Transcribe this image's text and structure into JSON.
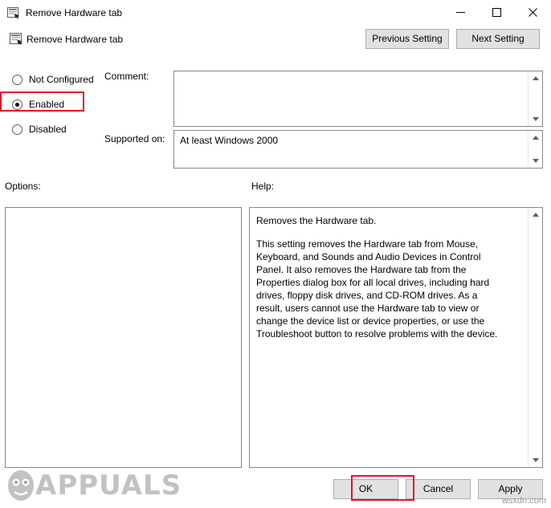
{
  "window": {
    "title": "Remove Hardware tab",
    "icon": "policy-setting-icon",
    "minimize_label": "─",
    "maximize_label": "☐",
    "close_label": "✕"
  },
  "header": {
    "icon": "policy-setting-icon",
    "title": "Remove Hardware tab",
    "previous_setting_label": "Previous Setting",
    "next_setting_label": "Next Setting"
  },
  "state_options": [
    {
      "label": "Not Configured",
      "selected": false
    },
    {
      "label": "Enabled",
      "selected": true
    },
    {
      "label": "Disabled",
      "selected": false
    }
  ],
  "comment": {
    "label": "Comment:",
    "value": "",
    "placeholder": ""
  },
  "supported_on": {
    "label": "Supported on:",
    "value": "At least Windows 2000"
  },
  "options": {
    "label": "Options:",
    "value": ""
  },
  "help": {
    "label": "Help:",
    "paragraphs": [
      "Removes the Hardware tab.",
      "This setting removes the Hardware tab from Mouse, Keyboard, and Sounds and Audio Devices in Control Panel. It also removes the Hardware tab from the Properties dialog box for all local drives, including hard drives, floppy disk drives, and CD-ROM drives. As a result, users cannot use the Hardware tab to view or change the device list or device properties, or use the Troubleshoot button to resolve problems with the device."
    ]
  },
  "footer": {
    "ok_label": "OK",
    "cancel_label": "Cancel",
    "apply_label": "Apply"
  },
  "watermark": {
    "text": "APPUALS",
    "corner": "wsxdn.com"
  },
  "colors": {
    "highlight": "#e81123",
    "button_face": "#e1e1e1",
    "button_border": "#adadad",
    "field_border": "#828790"
  }
}
